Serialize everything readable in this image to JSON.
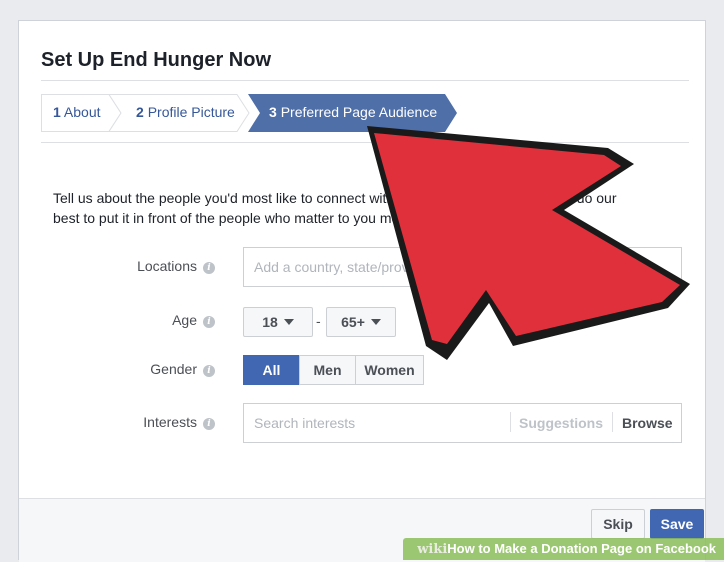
{
  "dialog": {
    "title": "Set Up End Hunger Now"
  },
  "steps": [
    {
      "num": "1",
      "label": "About",
      "active": false
    },
    {
      "num": "2",
      "label": "Profile Picture",
      "active": false
    },
    {
      "num": "3",
      "label": "Preferred Page Audience",
      "active": true
    }
  ],
  "intro_text": "Tell us about the people you'd most like to connect with. Any ... we'll do our best to put it in front of the people who matter to you most.",
  "intro_line1_left": "Tell us about the people you'd most like to connect with. An",
  "intro_line1_right": "t we'll do our",
  "intro_line2": "best to put it in front of the people who matter to you most.",
  "fields": {
    "locations": {
      "label": "Locations",
      "placeholder": "Add a country, state/province, city"
    },
    "age": {
      "label": "Age",
      "min": "18",
      "max": "65+",
      "separator": "-"
    },
    "gender": {
      "label": "Gender",
      "options": [
        "All",
        "Men",
        "Women"
      ],
      "selected": "All"
    },
    "interests": {
      "label": "Interests",
      "placeholder": "Search interests",
      "suggestions_label": "Suggestions",
      "browse_label": "Browse"
    }
  },
  "info_icon_glyph": "i",
  "footer": {
    "skip_label": "Skip",
    "save_label": "Save"
  },
  "colors": {
    "primary": "#4267b2",
    "link": "#365899",
    "annotation_arrow": "#e0303c"
  },
  "watermark": {
    "brand": "wiki",
    "text": "How to Make a Donation Page on Facebook"
  }
}
